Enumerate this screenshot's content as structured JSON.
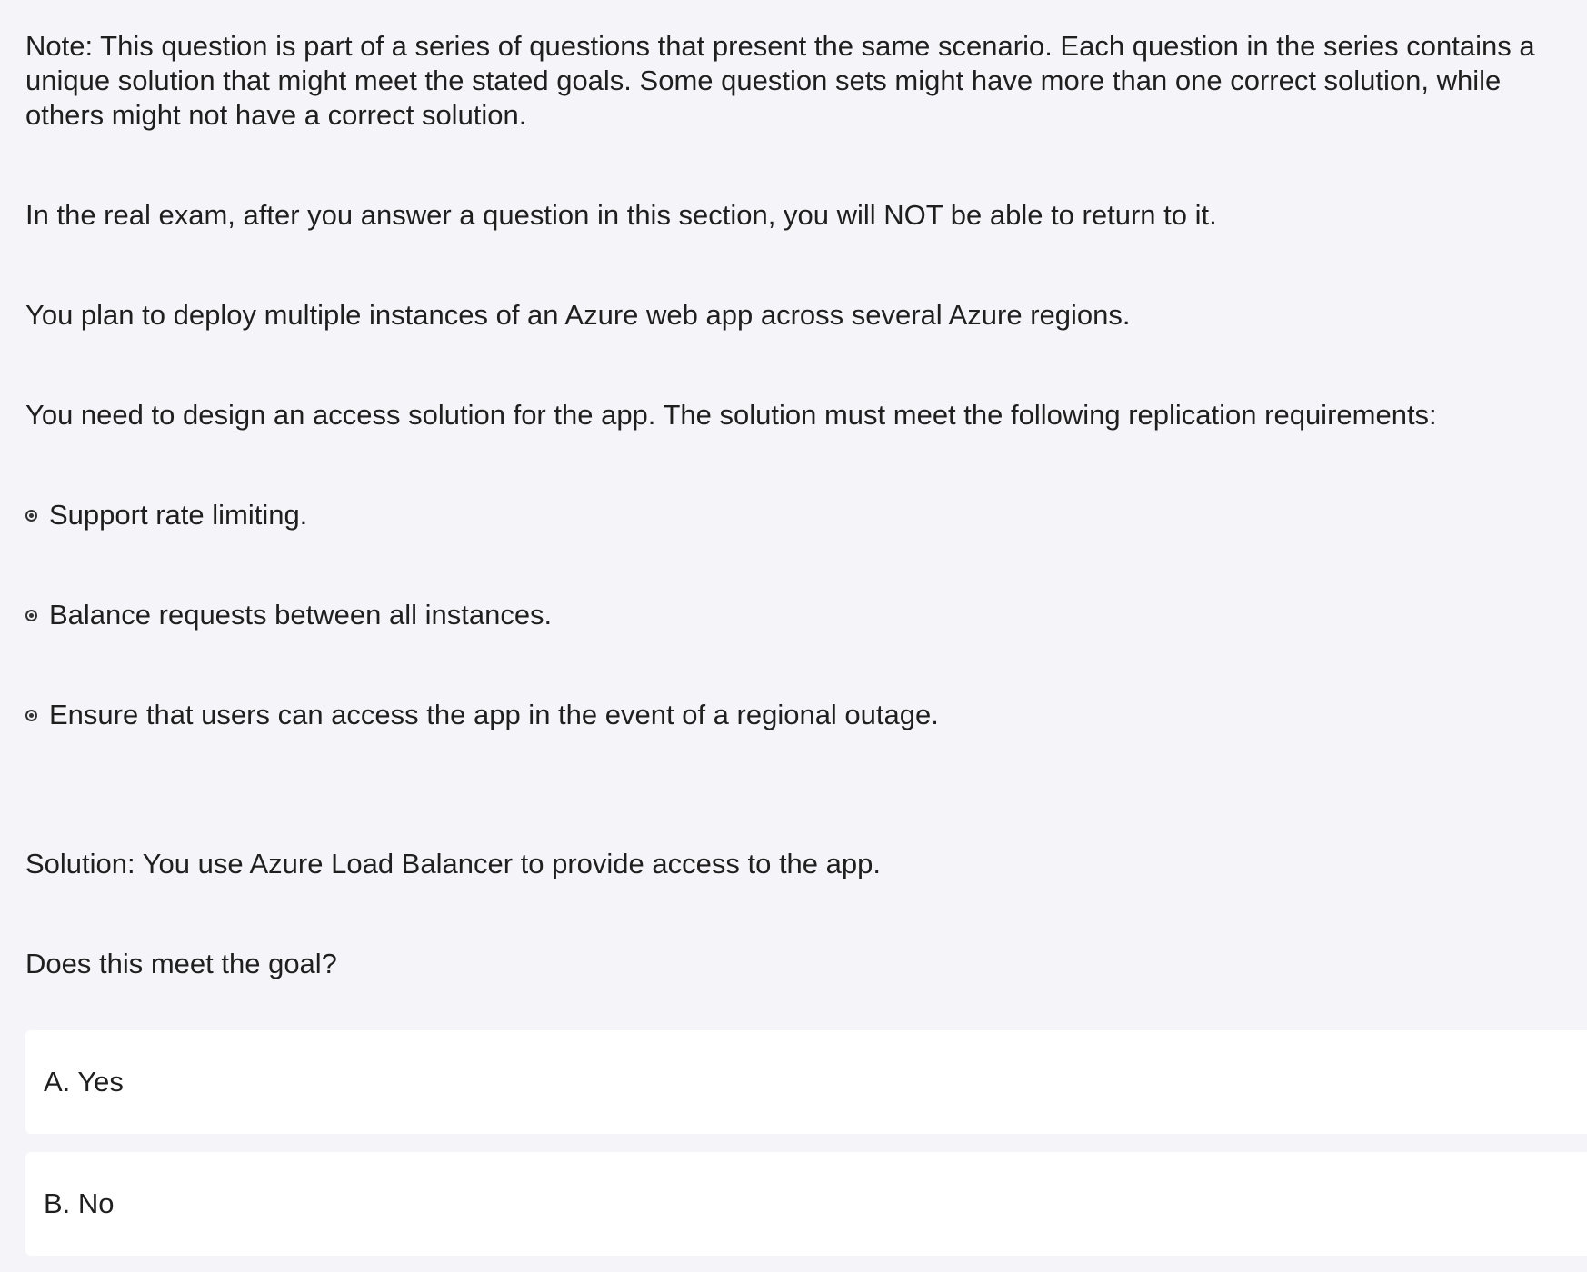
{
  "content": {
    "note": "Note: This question is part of a series of questions that present the same scenario. Each question in the series contains a unique solution that might meet the stated goals. Some question sets might have more than one correct solution, while others might not have a correct solution.",
    "exam_note": "In the real exam, after you answer a question in this section, you will NOT be able to return to it.",
    "scenario": "You plan to deploy multiple instances of an Azure web app across several Azure regions.",
    "requirement_intro": "You need to design an access solution for the app. The solution must meet the following replication requirements:",
    "requirements": [
      "Support rate limiting.",
      "Balance requests between all instances.",
      "Ensure that users can access the app in the event of a regional outage."
    ],
    "solution": "Solution: You use Azure Load Balancer to provide access to the app.",
    "question": "Does this meet the goal?"
  },
  "answers": [
    {
      "label": "A. Yes"
    },
    {
      "label": "B. No"
    }
  ],
  "icons": {
    "bullet": "radio-bullet-icon"
  }
}
